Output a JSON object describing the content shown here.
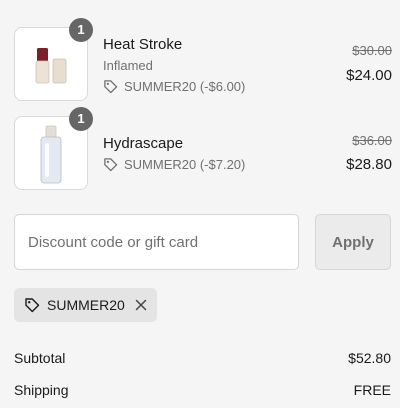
{
  "items": [
    {
      "name": "Heat Stroke",
      "variant": "Inflamed",
      "discount": "SUMMER20 (-$6.00)",
      "original_price": "$30.00",
      "price": "$24.00",
      "quantity": "1",
      "image_icon": "lipstick-product-icon"
    },
    {
      "name": "Hydrascape",
      "variant": "",
      "discount": "SUMMER20 (-$7.20)",
      "original_price": "$36.00",
      "price": "$28.80",
      "quantity": "1",
      "image_icon": "serum-bottle-product-icon"
    }
  ],
  "discount_form": {
    "placeholder": "Discount code or gift card",
    "apply_label": "Apply"
  },
  "applied_code": {
    "code": "SUMMER20"
  },
  "summary": {
    "subtotal_label": "Subtotal",
    "subtotal_value": "$52.80",
    "shipping_label": "Shipping",
    "shipping_value": "FREE"
  },
  "colors": {
    "background": "#f5f5f5",
    "badge": "#666666",
    "muted_text": "#707070",
    "tag_background": "#e4e4e4",
    "button_background": "#ebebeb"
  }
}
